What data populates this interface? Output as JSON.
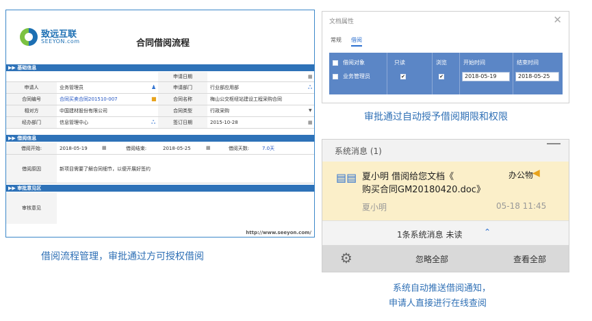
{
  "form": {
    "logo_cn": "致远互联",
    "logo_en": "SEEYON.com",
    "title": "合同借阅流程",
    "section_basic": "基础信息",
    "section_borrow": "借阅信息",
    "section_review": "审批意见区",
    "label_apply_date": "申请日期",
    "label_applicant": "申请人",
    "value_applicant": "业务管理员",
    "label_dept": "申请部门",
    "value_dept": "行业部应用部",
    "label_contract_no": "合同编号",
    "value_contract_no": "合同买卖合同201510-007",
    "label_contract_name": "合同名称",
    "value_contract_name": "梅山公交枢纽站建设工程采购合同",
    "label_counterparty": "相对方",
    "value_counterparty": "中国建材股份有限公司",
    "label_contract_type": "合同类型",
    "value_contract_type": "行政采购",
    "label_handler_dept": "经办部门",
    "value_handler_dept": "信息管理中心",
    "label_sign_date": "签订日期",
    "value_sign_date": "2015-10-28",
    "label_borrow_start": "借阅开始:",
    "value_borrow_start": "2018-05-19",
    "label_borrow_end": "借阅结束:",
    "value_borrow_end": "2018-05-25",
    "label_borrow_days": "借阅天数:",
    "value_borrow_days": "7.0天",
    "label_reason": "借阅原因",
    "value_reason": "新项目需要了解合同细节，以便开展好签约",
    "label_opinion": "审核意见",
    "footer_url": "http://www.seeyon.com/"
  },
  "perm": {
    "title": "文档属性",
    "tabs": [
      "常规",
      "借阅"
    ],
    "head_target": "借阅对象",
    "head_readonly": "只读",
    "head_browse": "浏览",
    "head_start": "开始时间",
    "head_end": "结束时间",
    "row_target": "业务管理员",
    "row_readonly": "✔",
    "row_browse": "✔",
    "row_start": "2018-05-19",
    "row_end": "2018-05-25"
  },
  "captions": {
    "perm": "审批通过自动授予借阅期限和权限",
    "flow": "借阅流程管理，审批通过方可授权借阅",
    "notify_line1": "系统自动推送借阅通知，",
    "notify_line2": "申请人直接进行在线查阅"
  },
  "notif": {
    "title": "系统消息 (1)",
    "msg_line1": "夏小明 借阅给您文档《",
    "msg_line2": "购买合同GM20180420.doc》",
    "msg_tag": "办公物",
    "sender": "夏小明",
    "time": "05-18 11:45",
    "unread": "1条系统消息 未读",
    "ignore_all": "忽略全部",
    "view_all": "查看全部"
  },
  "colors": {
    "accent_blue": "#2e72b8",
    "card_yellow": "#fbefc9",
    "caption_blue": "#2e6fb5"
  }
}
